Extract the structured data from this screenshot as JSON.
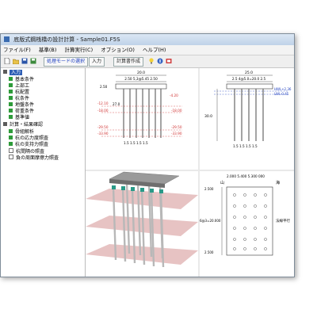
{
  "window": {
    "title": "底版式鋼桟橋の設計計算 - Sample01.F5S",
    "controls": [
      "min-icon",
      "max-icon",
      "close-icon"
    ]
  },
  "menu": [
    "ファイル(F)",
    "基準(B)",
    "計算実行(C)",
    "オプション(O)",
    "ヘルプ(H)"
  ],
  "toolbar": {
    "mode_button": "処理モードの選択",
    "input_button": "入力",
    "report_button": "計算書作成"
  },
  "tree": {
    "root": "入力",
    "items": [
      "基本条件",
      "上部工",
      "杭配置",
      "杭条件",
      "地盤条件",
      "荷重条件",
      "基準値"
    ],
    "calc_root": "計算・結果確認",
    "calc_items": [
      "骨組解析",
      "杭の応力度照査",
      "杭の支持力照査",
      "杭間隔の照査",
      "負の周面摩擦力照査"
    ]
  },
  "views": {
    "front": {
      "top_width": "20.0",
      "cap_dims": "2.50 5,3@5.45 2.50",
      "left_dim": "2.50",
      "elev_top": "-4.20",
      "level_labels": [
        "-12.10",
        "-18.00",
        "-29.50",
        "-33.90"
      ],
      "right_levels": [
        "-18.00",
        "-29.50",
        "-33.90"
      ],
      "mid_dims": "27.0",
      "bottom_dims": "1.5 1.5 1.5 1.5"
    },
    "side": {
      "top_width": "25.0",
      "cap_dims": "2.5 4@5.0=20.0 2.5",
      "wl_labels": [
        "HWL+2.36",
        "LWL-0.45"
      ],
      "depth": "30.0",
      "bottom_dims": "1.5 1.5 1.5 1.5"
    },
    "plan": {
      "top_dims": "2.000 5.400 5.300 000",
      "mountain": "山",
      "sea": "海",
      "left_dims": [
        "2.500",
        "6@3=20.000",
        "2.500"
      ],
      "right_text": "法線平行"
    }
  },
  "colors": {
    "pile": "#808080",
    "level_line": "#d03030",
    "water_line": "#2040c0",
    "tree_green": "#2e9b3a",
    "tree_blue": "#2f5fb5"
  }
}
